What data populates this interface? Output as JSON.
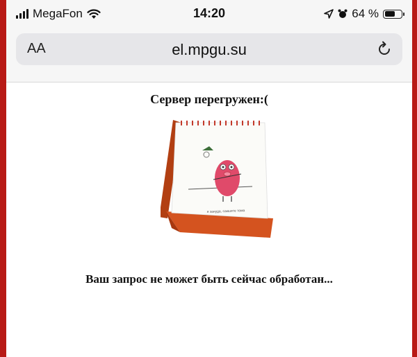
{
  "status_bar": {
    "carrier": "MegaFon",
    "time": "14:20",
    "battery": "64 %",
    "battery_level": 0.64
  },
  "address_bar": {
    "text_size_label": "AA",
    "url": "el.mpgu.su"
  },
  "page": {
    "title": "Сервер перегружен:(",
    "message": "Ваш запрос не может быть сейчас обработан...",
    "calendar_caption": "я зануда, сакшите тома"
  },
  "colors": {
    "background": "#b81a16",
    "calendar_stand": "#d4531f",
    "pig": "#e04a6a"
  }
}
